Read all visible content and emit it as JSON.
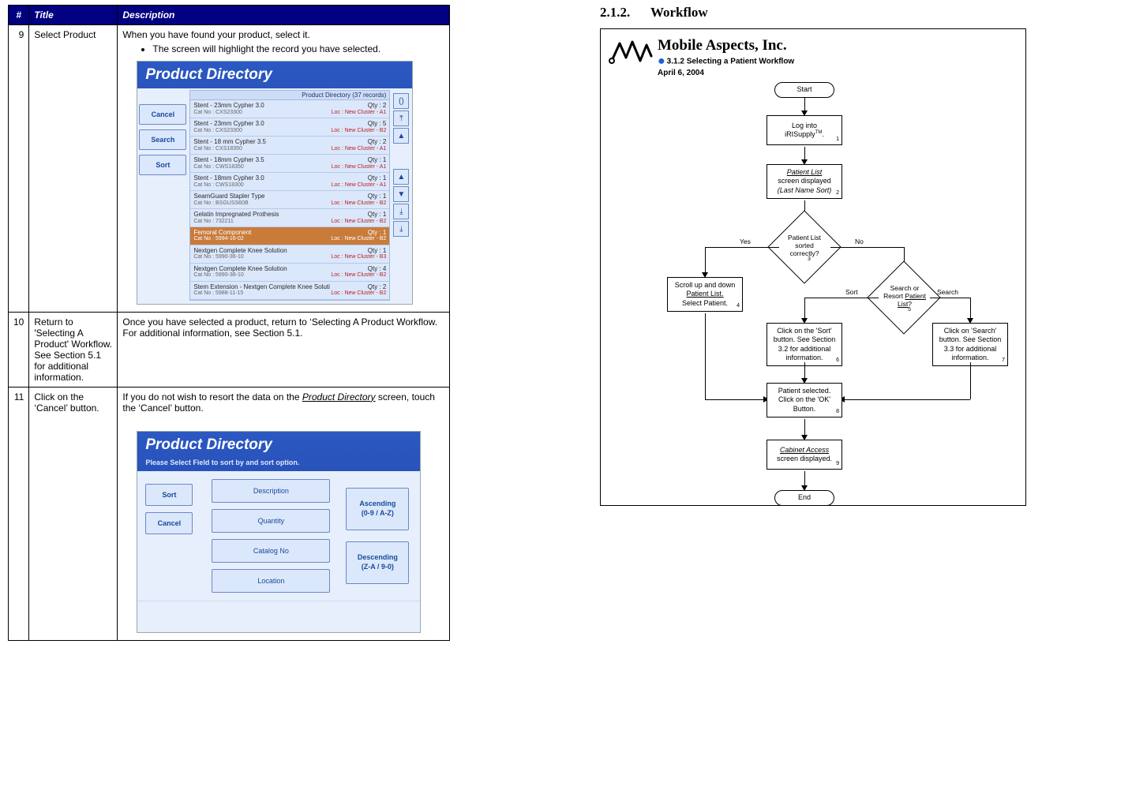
{
  "table": {
    "headers": {
      "num": "#",
      "title": "Title",
      "desc": "Description"
    },
    "rows": [
      {
        "num": "9",
        "title": "Select Product",
        "desc_line1": "When you have found your product, select it.",
        "bullet1": "The screen will highlight the record you have selected."
      },
      {
        "num": "10",
        "title": "Return to 'Selecting A Product' Workflow.  See Section 5.1 for additional information.",
        "desc": "Once you have selected a product, return to ‘Selecting A Product Workflow.  For additional information, see Section 5.1."
      },
      {
        "num": "11",
        "title": "Click on the ‘Cancel’ button.",
        "desc_line1": "If you do not wish to resort the data on the ",
        "desc_underline": "Product Directory",
        "desc_line2": " screen, touch the ‘Cancel’ button."
      }
    ]
  },
  "shot1": {
    "title": "Product Directory",
    "header": "Product Directory (37 records)",
    "side": {
      "cancel": "Cancel",
      "search": "Search",
      "sort": "Sort"
    },
    "rows": [
      {
        "name": "Stent - 23mm Cypher 3.0",
        "cat": "Cat No : CXS23300",
        "qty": "Qty : 2",
        "loc": "Loc : New Cluster -  A1"
      },
      {
        "name": "Stent - 23mm Cypher 3.0",
        "cat": "Cat No : CXS23300",
        "qty": "Qty : 5",
        "loc": "Loc : New Cluster -  B2"
      },
      {
        "name": "Stent - 18 mm Cypher 3.5",
        "cat": "Cat No : CXS18350",
        "qty": "Qty : 2",
        "loc": "Loc : New Cluster -  A1"
      },
      {
        "name": "Stent - 18mm Cypher 3.5",
        "cat": "Cat No : CWS18350",
        "qty": "Qty : 1",
        "loc": "Loc : New Cluster -  A1"
      },
      {
        "name": "Stent - 18mm Cypher 3.0",
        "cat": "Cat No : CWS18300",
        "qty": "Qty : 1",
        "loc": "Loc : New Cluster -  A1"
      },
      {
        "name": "SeamGuard Stapler Type",
        "cat": "Cat No : BSGUSS60B",
        "qty": "Qty : 1",
        "loc": "Loc : New Cluster -  B2"
      },
      {
        "name": "Gelatin Impregnated Prothesis",
        "cat": "Cat No : 732211",
        "qty": "Qty : 1",
        "loc": "Loc : New Cluster -  B2"
      },
      {
        "name": "Femoral Component",
        "cat": "Cat No : 5994-16-02",
        "qty": "Qty : 1",
        "loc": "Loc : New Cluster -  B2",
        "selected": true
      },
      {
        "name": "Nextgen Complete Knee Solution",
        "cat": "Cat No : 5990-36-10",
        "qty": "Qty : 1",
        "loc": "Loc : New Cluster -  B3"
      },
      {
        "name": "Nextgen Complete Knee Solution",
        "cat": "Cat No : 5990-36-10",
        "qty": "Qty : 4",
        "loc": "Loc : New Cluster -  B2"
      },
      {
        "name": "Stem Extension - Nextgen Complete Knee Soluti",
        "cat": "Cat No : 5988-11-15",
        "qty": "Qty : 2",
        "loc": "Loc : New Cluster -  B2"
      }
    ],
    "nav": [
      "()",
      "⤒",
      "▲",
      "▲",
      "▼",
      "⤓",
      "⤓"
    ]
  },
  "shot2": {
    "title": "Product Directory",
    "sub": "Please Select Field to sort by and sort option.",
    "left": {
      "sort": "Sort",
      "cancel": "Cancel"
    },
    "fields": [
      "Description",
      "Quantity",
      "Catalog No",
      "Location"
    ],
    "order1_l1": "Ascending",
    "order1_l2": "(0-9 / A-Z)",
    "order2_l1": "Descending",
    "order2_l2": "(Z-A / 9-0)"
  },
  "right": {
    "secnum": "2.1.2.",
    "sectitle": "Workflow",
    "company": "Mobile Aspects, Inc.",
    "subtitle": "3.1.2 Selecting a Patient Workflow",
    "date": "April 6, 2004",
    "start": "Start",
    "end": "End",
    "n1_l1": "Log into",
    "n1_l2a": "iRISupply",
    "n1_l2b": "TM",
    "n1_l2c": ".",
    "n2_l1": "Patient List",
    "n2_l2": "screen displayed",
    "n2_l3": "(Last Name Sort)",
    "d3_l1": "Patient List",
    "d3_l2": "sorted",
    "d3_l3": "correctly?",
    "n4_l1": "Scroll up and down",
    "n4_l2": "Patient List.",
    "n4_l3": "Select Patient.",
    "d5_l1": "Search or",
    "d5_l2a": "Resort  ",
    "d5_l2b": "Patient",
    "d5_l3a": "List",
    "d5_l3b": "?",
    "n6": "Click on the 'Sort' button.  See Section 3.2 for additional information.",
    "n7": "Click on 'Search' button.  See Section 3.3 for additional information.",
    "n8_l1": "Patient selected.",
    "n8_l2": "Click on the 'OK'",
    "n8_l3": "Button.",
    "n9_l1": "Cabinet Access",
    "n9_l2": "screen displayed.",
    "yes": "Yes",
    "no": "No",
    "sort": "Sort",
    "search": "Search",
    "b1": "1",
    "b2": "2",
    "b3": "3",
    "b4": "4",
    "b5": "5",
    "b6": "6",
    "b7": "7",
    "b8": "8",
    "b9": "9"
  }
}
